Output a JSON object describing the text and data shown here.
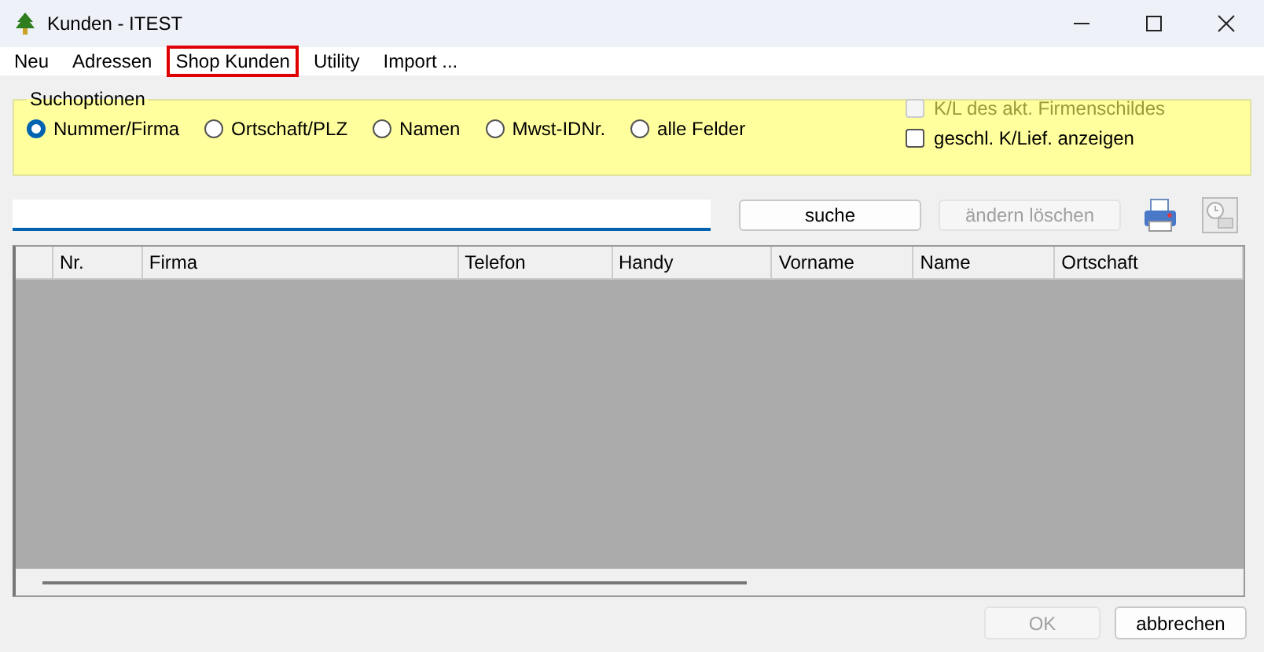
{
  "window": {
    "title": "Kunden - ITEST"
  },
  "menu": [
    {
      "label": "Neu",
      "highlighted": false
    },
    {
      "label": "Adressen",
      "highlighted": false
    },
    {
      "label": "Shop Kunden",
      "highlighted": true
    },
    {
      "label": "Utility",
      "highlighted": false
    },
    {
      "label": "Import ...",
      "highlighted": false
    }
  ],
  "search_options": {
    "title": "Suchoptionen",
    "radios": [
      {
        "label": "Nummer/Firma",
        "selected": true
      },
      {
        "label": "Ortschaft/PLZ",
        "selected": false
      },
      {
        "label": "Namen",
        "selected": false
      },
      {
        "label": "Mwst-IDNr.",
        "selected": false
      },
      {
        "label": "alle Felder",
        "selected": false
      }
    ],
    "checkboxes": [
      {
        "label": "K/L des akt. Firmenschildes",
        "checked": false,
        "disabled": true
      },
      {
        "label": "geschl. K/Lief. anzeigen",
        "checked": false,
        "disabled": false
      }
    ]
  },
  "buttons": [
    {
      "label": "suche",
      "disabled": false
    },
    {
      "label": "ändern löschen",
      "disabled": true
    }
  ],
  "tools": [
    {
      "kind": "printer",
      "disabled": false
    },
    {
      "kind": "clock",
      "disabled": true
    }
  ],
  "table": {
    "columns": [
      "Nr.",
      "Firma",
      "Telefon",
      "Handy",
      "Vorname",
      "Name",
      "Ortschaft"
    ]
  },
  "footer_buttons": [
    {
      "label": "OK",
      "disabled": true
    },
    {
      "label": "abbrechen",
      "disabled": false
    }
  ]
}
